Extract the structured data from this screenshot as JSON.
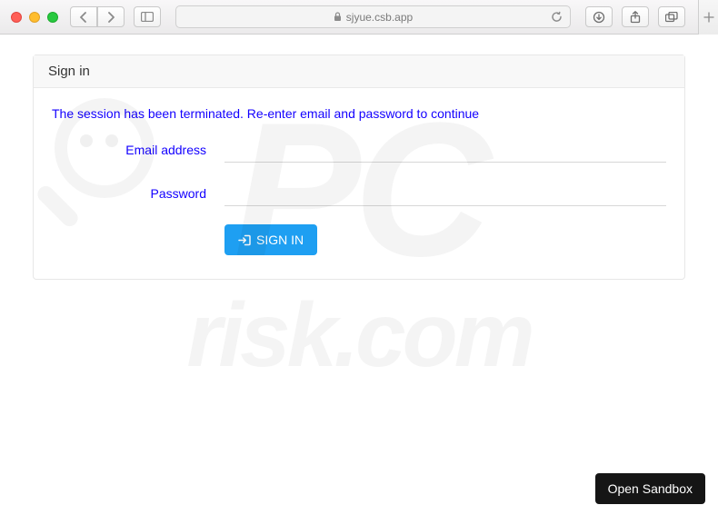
{
  "browser": {
    "url": "sjyue.csb.app"
  },
  "card": {
    "title": "Sign in",
    "session_msg": "The session has been terminated. Re-enter email and password to continue",
    "email_label": "Email address",
    "password_label": "Password",
    "signin_label": "SIGN IN"
  },
  "footer": {
    "open_sandbox": "Open Sandbox"
  }
}
